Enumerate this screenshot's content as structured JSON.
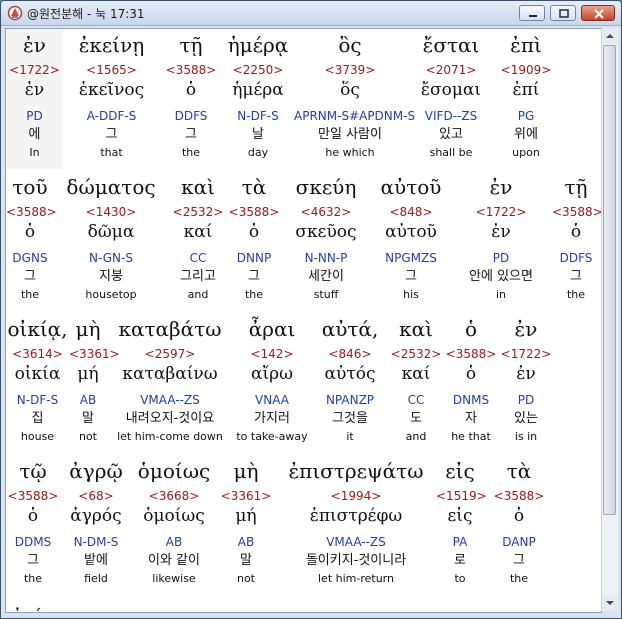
{
  "window": {
    "title": "@원전분해 - 눅 17:31"
  },
  "rows": [
    {
      "words": [
        {
          "greek": "ἐν",
          "strong": "<1722>",
          "lemma": "ἐν",
          "parse": "PD",
          "korean": "에",
          "english": "In"
        },
        {
          "greek": "ἐκείνῃ",
          "strong": "<1565>",
          "lemma": "ἐκεῖνος",
          "parse": "A-DDF-S",
          "korean": "그",
          "english": "that"
        },
        {
          "greek": "τῇ",
          "strong": "<3588>",
          "lemma": "ὁ",
          "parse": "DDFS",
          "korean": "그",
          "english": "the"
        },
        {
          "greek": "ἡμέρᾳ",
          "strong": "<2250>",
          "lemma": "ἡμέρα",
          "parse": "N-DF-S",
          "korean": "날",
          "english": "day"
        },
        {
          "greek": "ὃς",
          "strong": "<3739>",
          "lemma": "ὅς",
          "parse": "APRNM-S#APDNM-S",
          "korean": "만일 사람이",
          "english": "he which"
        },
        {
          "greek": "ἔσται",
          "strong": "<2071>",
          "lemma": "ἔσομαι",
          "parse": "VIFD--ZS",
          "korean": "있고",
          "english": "shall be"
        },
        {
          "greek": "ἐπὶ",
          "strong": "<1909>",
          "lemma": "ἐπί",
          "parse": "PG",
          "korean": "위에",
          "english": "upon"
        }
      ]
    },
    {
      "words": [
        {
          "greek": "τοῦ",
          "strong": "<3588>",
          "lemma": "ὁ",
          "parse": "DGNS",
          "korean": "그",
          "english": "the"
        },
        {
          "greek": "δώματος",
          "strong": "<1430>",
          "lemma": "δῶμα",
          "parse": "N-GN-S",
          "korean": "지붕",
          "english": "housetop"
        },
        {
          "greek": "καὶ",
          "strong": "<2532>",
          "lemma": "καί",
          "parse": "CC",
          "korean": "그리고",
          "english": "and"
        },
        {
          "greek": "τὰ",
          "strong": "<3588>",
          "lemma": "ὁ",
          "parse": "DNNP",
          "korean": "그",
          "english": "the"
        },
        {
          "greek": "σκεύη",
          "strong": "<4632>",
          "lemma": "σκεῦος",
          "parse": "N-NN-P",
          "korean": "세간이",
          "english": "stuff"
        },
        {
          "greek": "αὐτοῦ",
          "strong": "<848>",
          "lemma": "αὐτοῦ",
          "parse": "NPGMZS",
          "korean": "그",
          "english": "his"
        },
        {
          "greek": "ἐν",
          "strong": "<1722>",
          "lemma": "ἐν",
          "parse": "PD",
          "korean": "안에 있으면",
          "english": "in"
        },
        {
          "greek": "τῇ",
          "strong": "<3588>",
          "lemma": "ὁ",
          "parse": "DDFS",
          "korean": "그",
          "english": "the"
        }
      ]
    },
    {
      "words": [
        {
          "greek": "οἰκίᾳ,",
          "strong": "<3614>",
          "lemma": "οἰκία",
          "parse": "N-DF-S",
          "korean": "집",
          "english": "house"
        },
        {
          "greek": "μὴ",
          "strong": "<3361>",
          "lemma": "μή",
          "parse": "AB",
          "korean": "말",
          "english": "not"
        },
        {
          "greek": "καταβάτω",
          "strong": "<2597>",
          "lemma": "καταβαίνω",
          "parse": "VMAA--ZS",
          "korean": "내려오지-것이요",
          "english": "let him-come down"
        },
        {
          "greek": "ἆραι",
          "strong": "<142>",
          "lemma": "αἴρω",
          "parse": "VNAA",
          "korean": "가지러",
          "english": "to take-away"
        },
        {
          "greek": "αὐτά,",
          "strong": "<846>",
          "lemma": "αὐτός",
          "parse": "NPANZP",
          "korean": "그것을",
          "english": "it"
        },
        {
          "greek": "καὶ",
          "strong": "<2532>",
          "lemma": "καί",
          "parse": "CC",
          "korean": "도",
          "english": "and"
        },
        {
          "greek": "ὁ",
          "strong": "<3588>",
          "lemma": "ὁ",
          "parse": "DNMS",
          "korean": "자",
          "english": "he that"
        },
        {
          "greek": "ἐν",
          "strong": "<1722>",
          "lemma": "ἐν",
          "parse": "PD",
          "korean": "있는",
          "english": "is in"
        }
      ]
    },
    {
      "words": [
        {
          "greek": "τῷ",
          "strong": "<3588>",
          "lemma": "ὁ",
          "parse": "DDMS",
          "korean": "그",
          "english": "the"
        },
        {
          "greek": "ἀγρῷ",
          "strong": "<68>",
          "lemma": "ἀγρός",
          "parse": "N-DM-S",
          "korean": "밭에",
          "english": "field"
        },
        {
          "greek": "ὁμοίως",
          "strong": "<3668>",
          "lemma": "ὁμοίως",
          "parse": "AB",
          "korean": "이와 같이",
          "english": "likewise"
        },
        {
          "greek": "μὴ",
          "strong": "<3361>",
          "lemma": "μή",
          "parse": "AB",
          "korean": "말",
          "english": "not"
        },
        {
          "greek": "ἐπιστρεψάτω",
          "strong": "<1994>",
          "lemma": "ἐπιστρέφω",
          "parse": "VMAA--ZS",
          "korean": "돌이키지-것이니라",
          "english": "let him-return"
        },
        {
          "greek": "εἰς",
          "strong": "<1519>",
          "lemma": "εἰς",
          "parse": "PA",
          "korean": "로",
          "english": "to"
        },
        {
          "greek": "τὰ",
          "strong": "<3588>",
          "lemma": "ὁ",
          "parse": "DANP",
          "korean": "그",
          "english": "the"
        }
      ]
    }
  ],
  "partial_next_line": "ὀπίσω."
}
